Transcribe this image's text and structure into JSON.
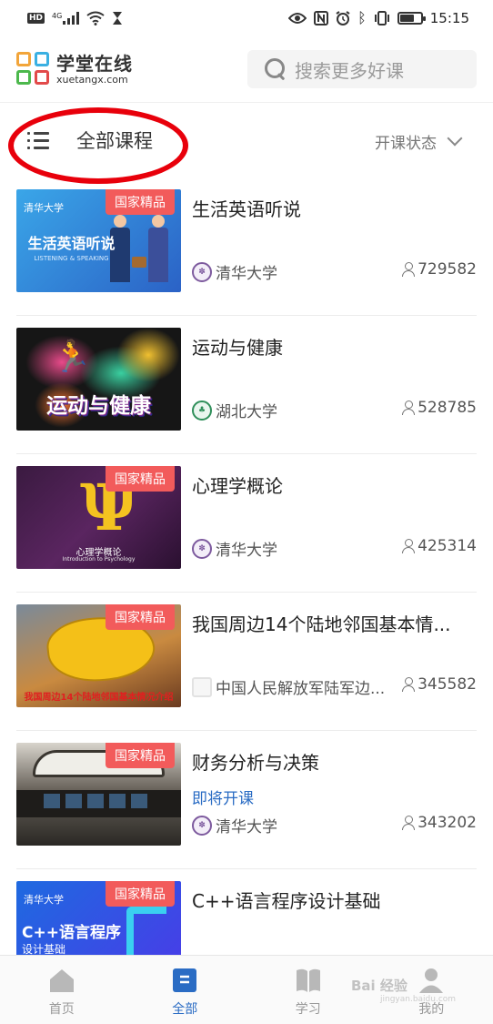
{
  "status_bar": {
    "hd_badge": "HD",
    "network": "4G",
    "time": "15:15",
    "battery_level": 0.7,
    "icons": [
      "signal-icon",
      "wifi-icon",
      "hourglass-icon",
      "eye-icon",
      "nfc-icon",
      "alarm-icon",
      "bluetooth-icon",
      "vibrate-icon",
      "battery-icon"
    ]
  },
  "header": {
    "logo_cn": "学堂在线",
    "logo_en": "xuetangx.com",
    "search_placeholder": "搜索更多好课"
  },
  "filter": {
    "all_courses": "全部课程",
    "status_label": "开课状态"
  },
  "courses": [
    {
      "title": "生活英语听说",
      "badge": "国家精品",
      "school": "清华大学",
      "enrolled": "729582",
      "thumb_title": "生活英语听说",
      "thumb_sub": "LISTENING & SPEAKING",
      "thumb_brand": "清华大学"
    },
    {
      "title": "运动与健康",
      "badge": "",
      "school": "湖北大学",
      "enrolled": "528785",
      "thumb_title": "运动与健康"
    },
    {
      "title": "心理学概论",
      "badge": "国家精品",
      "school": "清华大学",
      "enrolled": "425314",
      "thumb_title": "心理学概论",
      "thumb_sub": "Introduction to Psychology"
    },
    {
      "title": "我国周边14个陆地邻国基本情...",
      "badge": "国家精品",
      "school": "中国人民解放军陆军边...",
      "enrolled": "345582",
      "thumb_title": "我国周边14个陆地邻国基本情况介绍"
    },
    {
      "title": "财务分析与决策",
      "badge": "国家精品",
      "status": "即将开课",
      "school": "清华大学",
      "enrolled": "343202"
    },
    {
      "title": "C++语言程序设计基础",
      "badge": "国家精品",
      "thumb_title": "C++语言程序",
      "thumb_sub": "设计基础",
      "thumb_brand": "清华大学"
    }
  ],
  "tabs": [
    {
      "label": "首页",
      "icon": "home-icon",
      "active": false
    },
    {
      "label": "全部",
      "icon": "all-courses-icon",
      "active": true
    },
    {
      "label": "学习",
      "icon": "book-icon",
      "active": false
    },
    {
      "label": "我的",
      "icon": "profile-icon",
      "active": false
    }
  ],
  "watermark": {
    "brand": "Bai 经验",
    "url": "jingyan.baidu.com"
  },
  "colors": {
    "accent": "#2a6cc4",
    "badge": "#f25b5b",
    "highlight_ring": "#e8000b"
  }
}
